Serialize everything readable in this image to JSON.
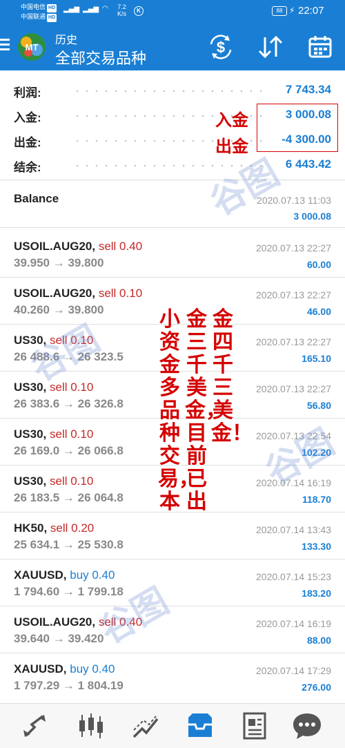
{
  "status_bar": {
    "carrier1": "中国电信",
    "carrier2": "中国联通",
    "hd": "HD",
    "network": "4G",
    "speed_value": "7.2",
    "speed_unit": "K/s",
    "battery": "88",
    "time": "22:07"
  },
  "header": {
    "title": "历史",
    "subtitle": "全部交易品种",
    "icons": [
      "menu-icon",
      "mt-logo-icon",
      "currency-exchange-icon",
      "sort-icon",
      "calendar-icon"
    ]
  },
  "summary": [
    {
      "label": "利润:",
      "value": "7 743.34"
    },
    {
      "label": "入金:",
      "value": "3 000.08"
    },
    {
      "label": "出金:",
      "value": "-4 300.00"
    },
    {
      "label": "结余:",
      "value": "6 443.42"
    }
  ],
  "annotations": {
    "deposit": "入金",
    "withdrawal": "出金",
    "col_right": "金四千三美金！",
    "col_mid": "金三千美金，目前已出",
    "col_left": "小资金多品种交易，本"
  },
  "balance_entry": {
    "label": "Balance",
    "time": "2020.07.13 11:03",
    "amount": "3 000.08"
  },
  "deals": [
    {
      "symbol": "USOIL.AUG20,",
      "side": "sell",
      "side_text": "sell 0.40",
      "prices": "39.950 → 39.800",
      "time": "2020.07.13 22:27",
      "profit": "60.00"
    },
    {
      "symbol": "USOIL.AUG20,",
      "side": "sell",
      "side_text": "sell 0.10",
      "prices": "40.260 → 39.800",
      "time": "2020.07.13 22:27",
      "profit": "46.00"
    },
    {
      "symbol": "US30,",
      "side": "sell",
      "side_text": "sell 0.10",
      "prices": "26 488.6 → 26 323.5",
      "time": "2020.07.13 22:27",
      "profit": "165.10"
    },
    {
      "symbol": "US30,",
      "side": "sell",
      "side_text": "sell 0.10",
      "prices": "26 383.6 → 26 326.8",
      "time": "2020.07.13 22:27",
      "profit": "56.80"
    },
    {
      "symbol": "US30,",
      "side": "sell",
      "side_text": "sell 0.10",
      "prices": "26 169.0 → 26 066.8",
      "time": "2020.07.13 22:54",
      "profit": "102.20"
    },
    {
      "symbol": "US30,",
      "side": "sell",
      "side_text": "sell 0.10",
      "prices": "26 183.5 → 26 064.8",
      "time": "2020.07.14 16:19",
      "profit": "118.70"
    },
    {
      "symbol": "HK50,",
      "side": "sell",
      "side_text": "sell 0.20",
      "prices": "25 634.1 → 25 530.8",
      "time": "2020.07.14 13:43",
      "profit": "133.30"
    },
    {
      "symbol": "XAUUSD,",
      "side": "buy",
      "side_text": "buy 0.40",
      "prices": "1 794.60 → 1 799.18",
      "time": "2020.07.14 15:23",
      "profit": "183.20"
    },
    {
      "symbol": "USOIL.AUG20,",
      "side": "sell",
      "side_text": "sell 0.40",
      "prices": "39.640 → 39.420",
      "time": "2020.07.14 16:19",
      "profit": "88.00"
    },
    {
      "symbol": "XAUUSD,",
      "side": "buy",
      "side_text": "buy 0.40",
      "prices": "1 797.29 → 1 804.19",
      "time": "2020.07.14 17:29",
      "profit": "276.00"
    }
  ],
  "bottom_nav": [
    "quotes-icon",
    "chart-icon",
    "trade-icon",
    "history-icon",
    "news-icon",
    "messages-icon"
  ],
  "colors": {
    "primary": "#1a7fd4",
    "sell": "#c62828",
    "buy": "#1a7fd4",
    "annotation": "#d40000"
  }
}
